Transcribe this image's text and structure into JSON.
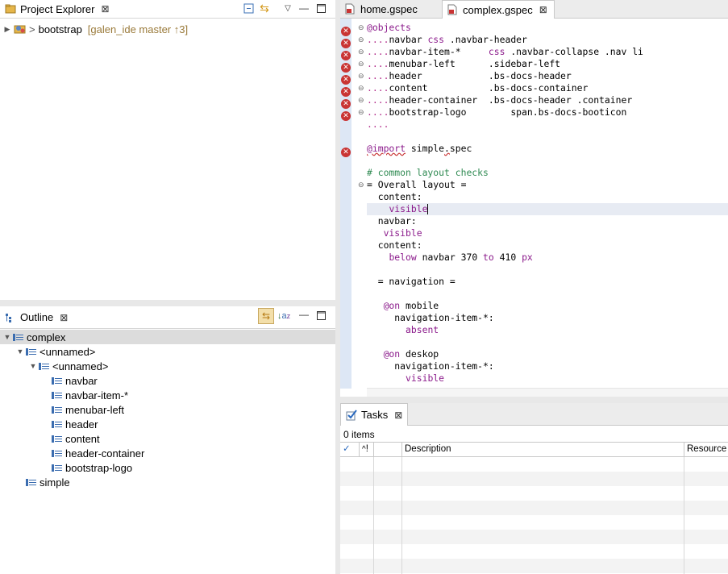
{
  "project_explorer": {
    "tab_label": "Project Explorer",
    "project_name": "bootstrap",
    "project_decoration": "[galen_ide master ↑3]"
  },
  "outline": {
    "tab_label": "Outline",
    "tree": [
      {
        "label": "complex",
        "depth": 0,
        "expanded": true
      },
      {
        "label": "<unnamed>",
        "depth": 1,
        "expanded": true
      },
      {
        "label": "<unnamed>",
        "depth": 2,
        "expanded": true
      },
      {
        "label": "navbar",
        "depth": 3
      },
      {
        "label": "navbar-item-*",
        "depth": 3
      },
      {
        "label": "menubar-left",
        "depth": 3
      },
      {
        "label": "header",
        "depth": 3
      },
      {
        "label": "content",
        "depth": 3
      },
      {
        "label": "header-container",
        "depth": 3
      },
      {
        "label": "bootstrap-logo",
        "depth": 3
      },
      {
        "label": "simple",
        "depth": 1
      }
    ]
  },
  "editor": {
    "tabs": [
      {
        "label": "home.gspec",
        "active": false
      },
      {
        "label": "complex.gspec",
        "active": true
      }
    ],
    "code": {
      "l1_kw": "@objects",
      "obj1_name": "navbar",
      "obj1_kw": "css",
      "obj1_sel": ".navbar-header",
      "obj2_name": "navbar-item-*",
      "obj2_kw": "css",
      "obj2_sel": ".navbar-collapse .nav li",
      "obj3_name": "menubar-left",
      "obj3_sel": ".sidebar-left",
      "obj4_name": "header",
      "obj4_sel": ".bs-docs-header",
      "obj5_name": "content",
      "obj5_sel": ".bs-docs-container",
      "obj6_name": "header-container",
      "obj6_sel": ".bs-docs-header .container",
      "obj7_name": "bootstrap-logo",
      "obj7_sel": "span.bs-docs-booticon",
      "import_kw": "@import",
      "import_arg": "simple",
      "import_dot": ".",
      "import_ext": "spec",
      "comment": "# common layout checks",
      "section1": "= Overall layout =",
      "content1": "content:",
      "visible1": "visible",
      "navbar": "navbar:",
      "visible2": "visible",
      "content2": "content:",
      "below": "below",
      "below_obj": "navbar",
      "below_n1": "370",
      "to": "to",
      "below_n2": "410",
      "px": "px",
      "section2": "= navigation =",
      "on1": "@on",
      "on1_tag": "mobile",
      "nav_item1": "navigation-item-*:",
      "absent": "absent",
      "on2": "@on",
      "on2_tag": "deskop",
      "nav_item2": "navigation-item-*:",
      "visible3": "visible"
    }
  },
  "tasks": {
    "tab_label": "Tasks",
    "count": "0 items",
    "columns": {
      "check": "✓",
      "priority": "!",
      "description": "Description",
      "resource": "Resource"
    }
  },
  "colors": {
    "error": "#c93434",
    "keyword": "#8b1a8b",
    "comment": "#2f8a52",
    "selection": "#e7ebf3"
  }
}
